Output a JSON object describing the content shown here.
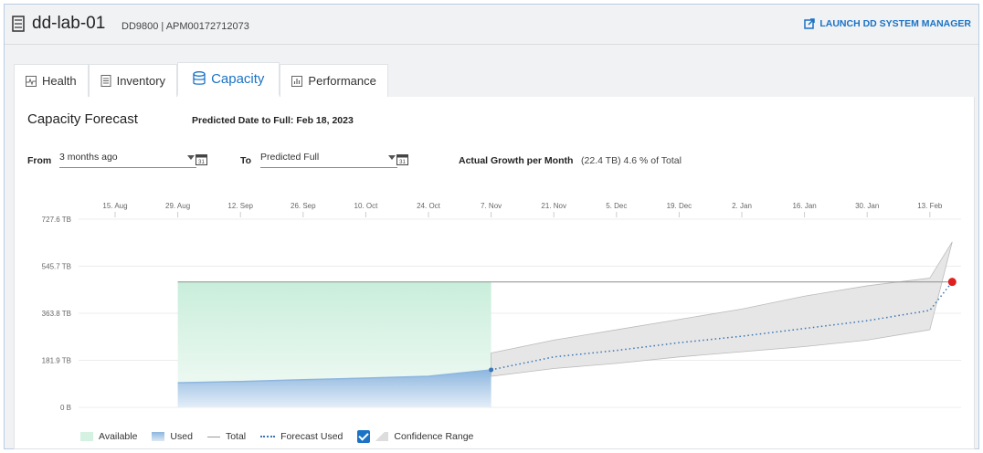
{
  "header": {
    "system_name": "dd-lab-01",
    "system_info": "DD9800 | APM00172712073",
    "launch_label": "LAUNCH DD SYSTEM MANAGER"
  },
  "tabs": [
    {
      "label": "Health",
      "icon": "pulse-icon"
    },
    {
      "label": "Inventory",
      "icon": "list-icon"
    },
    {
      "label": "Capacity",
      "icon": "database-icon",
      "active": true
    },
    {
      "label": "Performance",
      "icon": "bar-chart-icon"
    }
  ],
  "capacity": {
    "section_title": "Capacity Forecast",
    "predicted_text": "Predicted Date to Full: Feb 18, 2023",
    "from_label": "From",
    "from_value": "3 months ago",
    "to_label": "To",
    "to_value": "Predicted Full",
    "growth_label": "Actual Growth per Month",
    "growth_value": "(22.4 TB) 4.6 % of Total"
  },
  "colors": {
    "accent": "#1a73c5",
    "available": "#d4f1e2",
    "used": "#8db6df",
    "total_line": "#999999",
    "forecast": "#3a75b5",
    "confidence": "#e6e6e6",
    "full_marker": "#e02020"
  },
  "chart_data": {
    "type": "area",
    "x_ticks": [
      "15. Aug",
      "29. Aug",
      "12. Sep",
      "26. Sep",
      "10. Oct",
      "24. Oct",
      "7. Nov",
      "21. Nov",
      "5. Dec",
      "19. Dec",
      "2. Jan",
      "16. Jan",
      "30. Jan",
      "13. Feb"
    ],
    "y_ticks": [
      "727.6 TB",
      "545.7 TB",
      "363.8 TB",
      "181.9 TB",
      "0 B"
    ],
    "ylim": [
      0,
      727.6
    ],
    "total_capacity": 485,
    "series": [
      {
        "name": "Used",
        "x": [
          "2022-08-29",
          "2022-09-12",
          "2022-09-26",
          "2022-10-10",
          "2022-10-24",
          "2022-11-07"
        ],
        "values": [
          95,
          100,
          107,
          113,
          120,
          145
        ]
      },
      {
        "name": "Forecast Used",
        "x": [
          "2022-11-07",
          "2022-11-21",
          "2022-12-05",
          "2022-12-19",
          "2023-01-02",
          "2023-01-16",
          "2023-01-30",
          "2023-02-13",
          "2023-02-18"
        ],
        "values": [
          145,
          195,
          220,
          250,
          275,
          305,
          335,
          375,
          485
        ]
      },
      {
        "name": "Confidence Range",
        "lower": [
          120,
          150,
          170,
          195,
          215,
          235,
          260,
          300
        ],
        "upper": [
          210,
          260,
          300,
          340,
          380,
          430,
          470,
          500,
          640
        ]
      }
    ],
    "legend": [
      "Available",
      "Used",
      "Total",
      "Forecast Used",
      "Confidence Range"
    ],
    "legend_position": "bottom-left"
  }
}
